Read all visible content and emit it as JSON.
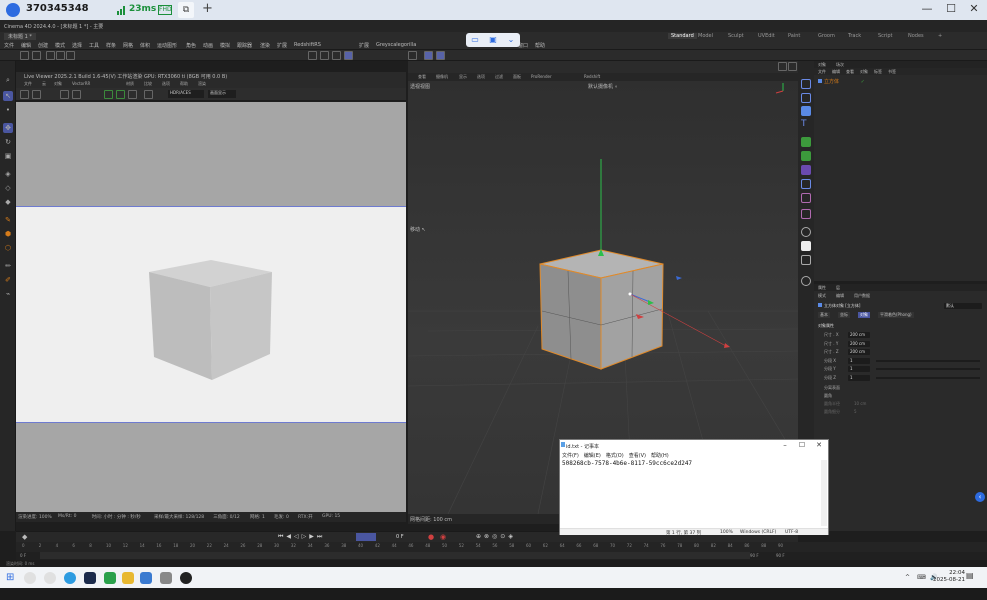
{
  "remote": {
    "session_id": "370345348",
    "ping": "23ms",
    "badge": "FHD",
    "tab_icon": "⧉",
    "new_tab": "+",
    "win_min": "—",
    "win_max": "☐",
    "win_close": "✕"
  },
  "app": {
    "title": "Cinema 4D 2024.4.0 - [未标题 1 *] - 主要",
    "doc_tab": "未标题 1 *",
    "menus": [
      "文件",
      "编辑",
      "创建",
      "模式",
      "选择",
      "工具",
      "样条",
      "网格",
      "体积",
      "运动图形",
      "角色",
      "动画",
      "模拟",
      "跟踪器",
      "渲染",
      "扩展",
      "RedshiftRS",
      "扩展",
      "Greyscalegorilla",
      "Octane",
      "窗口",
      "帮助"
    ],
    "layouts": [
      "Standard",
      "Model",
      "Sculpt",
      "UVEdit",
      "Paint",
      "Groom",
      "Track",
      "Script",
      "Nodes",
      "+"
    ],
    "active_layout": "Standard"
  },
  "left_view": {
    "header1": "Live Viewer 2025.2.1 Build 1.6-45(V)  工作站渲染 GPU: RTX3060 ti (8GB 可用 0.0 B)",
    "menus": [
      "文件",
      "云",
      "对象",
      "VectorRR",
      "材质",
      "比较",
      "选项",
      "帮助",
      "渲染"
    ],
    "mode_select": "HDR/ACES",
    "preset_select": "画面显示",
    "status": [
      "渲染进度: 100%",
      "Ms/Rt: 0",
      "时间: 小时 : 分钟 : 秒/秒",
      "采样/最大采样: 128/128",
      "三角面: 0/12",
      "网格: 1",
      "毛发: 0",
      "RTX:开",
      "GPU: 15"
    ]
  },
  "right_view": {
    "header": [
      "查看",
      "摄像机",
      "显示",
      "选项",
      "过滤",
      "面板",
      "ProRender",
      "Redshift"
    ],
    "label": "透视视图",
    "camera": "默认摄像机 ∘",
    "move_label": "移动 ↖",
    "grid_status": "网格间距: 100 cm"
  },
  "object_manager": {
    "tabs": [
      "对象",
      "场次"
    ],
    "menus": [
      "文件",
      "编辑",
      "查看",
      "对象",
      "标签",
      "书签"
    ],
    "object_name": "立方体"
  },
  "attributes": {
    "tabs": [
      "属性",
      "层"
    ],
    "menus": [
      "模式",
      "编辑",
      "用户数据"
    ],
    "object_line": "立方体对象 [立方体]",
    "preset": "默认",
    "subtabs": [
      "基本",
      "坐标",
      "对象",
      "平滑着色(Phong)"
    ],
    "section": "对象属性",
    "rows": [
      {
        "label": "尺寸 . X",
        "value": "200 cm"
      },
      {
        "label": "尺寸 . Y",
        "value": "200 cm"
      },
      {
        "label": "尺寸 . Z",
        "value": "200 cm"
      },
      {
        "label": "分段 X",
        "value": "1"
      },
      {
        "label": "分段 Y",
        "value": "1"
      },
      {
        "label": "分段 Z",
        "value": "1"
      }
    ],
    "extra": [
      "分离表面",
      "圆角",
      "圆角半径",
      "圆角细分"
    ],
    "extra_values": [
      "10 cm",
      "5"
    ]
  },
  "timeline": {
    "current": "0 F",
    "ticks": [
      "0",
      "2",
      "4",
      "6",
      "8",
      "10",
      "12",
      "14",
      "16",
      "18",
      "20",
      "22",
      "24",
      "26",
      "28",
      "30",
      "32",
      "34",
      "36",
      "38",
      "40",
      "42",
      "44",
      "46",
      "48",
      "50",
      "52",
      "54",
      "56",
      "58",
      "60",
      "62",
      "64",
      "66",
      "68",
      "70",
      "72",
      "74",
      "76",
      "78",
      "80",
      "82",
      "84",
      "86",
      "88",
      "90"
    ],
    "start": "0 F",
    "start2": "0 F",
    "end": "90 F",
    "end2": "90 F",
    "status": "渲染时间: 0 ms"
  },
  "notepad": {
    "title": "id.txt - 记事本",
    "menus": [
      "文件(F)",
      "编辑(E)",
      "格式(O)",
      "查看(V)",
      "帮助(H)"
    ],
    "content": "508268cb-7578-4b6e-8117-59cc6ce2d247",
    "status": [
      "第 1 行, 第 37 列",
      "100%",
      "Windows (CRLF)",
      "UTF-8"
    ]
  },
  "taskbar": {
    "time": "22:04",
    "date": "2025-08-21",
    "tray": [
      "^",
      "⌨",
      "🔊"
    ]
  },
  "colors": {
    "accent": "#2d6be0",
    "orange": "#d67c1a",
    "select_blue": "#6e7bd0"
  }
}
